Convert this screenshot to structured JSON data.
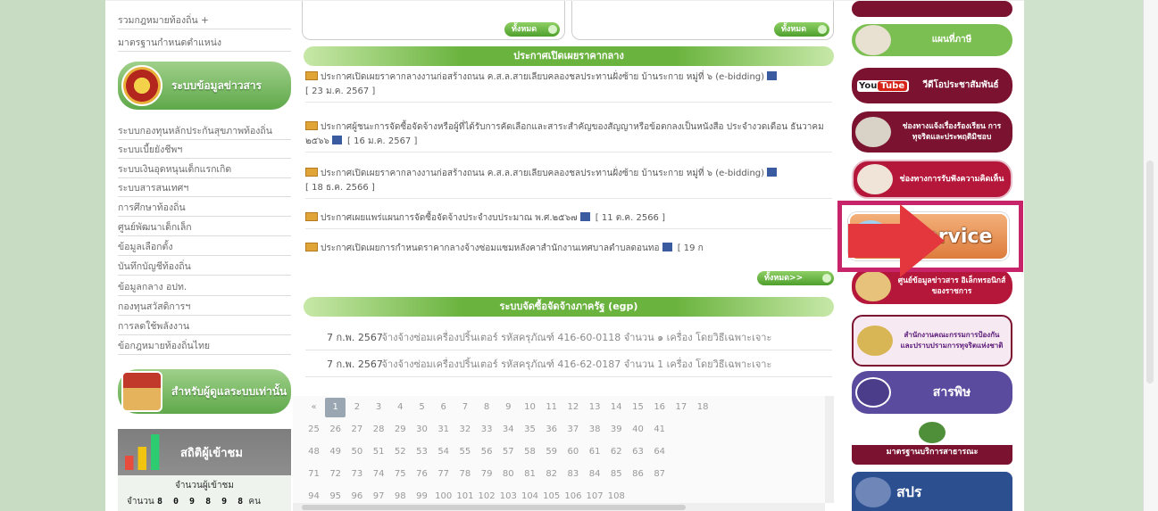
{
  "sidebar": {
    "top_links": [
      "รวมกฎหมายท้องถิ่น +",
      "มาตรฐานกำหนดตำแหน่ง"
    ],
    "banner_info": "ระบบข้อมูลข่าวสาร",
    "links": [
      "ระบบกองทุนหลักประกันสุขภาพท้องถิ่น",
      "ระบบเบี้ยยังชีพฯ",
      "ระบบเงินอุดหนุนเด็กแรกเกิด",
      "ระบบสารสนเทศฯ",
      "การศึกษาท้องถิ่น",
      "ศูนย์พัฒนาเด็กเล็ก",
      "ข้อมูลเลือกตั้ง",
      "บันทึกบัญชีท้องถิ่น",
      "ข้อมูลกลาง อปท.",
      "กองทุนสวัสดิการฯ",
      "การลดใช้พลังงาน",
      "ข้อกฎหมายท้องถิ่นไทย"
    ],
    "banner_admin": "สำหรับผู้ดูแลระบบเท่านั้น",
    "stats": {
      "title": "สถิติผู้เข้าชม",
      "label": "จำนวนผู้เข้าชม",
      "prefix": "จำนวน",
      "digits": "8 0 9 8 9 8",
      "suffix": "คน"
    }
  },
  "center": {
    "pill_all_1": "ทั้งหมด",
    "pill_all_2": "ทั้งหมด",
    "section_announce": "ประกาศเปิดเผยราคากลาง",
    "announcements": [
      {
        "text": "ประกาศเปิดเผยราคากลางงานก่อสร้างถนน ค.ส.ล.สายเลียบคลองชลประทานฝั่งซ้าย บ้านระกาย หมู่ที่ ๖ (e-bidding)",
        "date": "[ 23 ม.ค. 2567 ]"
      },
      {
        "text": "ประกาศผู้ชนะการจัดซื้อจัดจ้างหรือผู้ที่ได้รับการคัดเลือกและสาระสำคัญของสัญญาหรือข้อตกลงเป็นหนังสือ ประจำงวดเดือน ธันวาคม ๒๕๖๖",
        "date": "[ 16 ม.ค. 2567 ]"
      },
      {
        "text": "ประกาศเปิดเผยราคากลางงานก่อสร้างถนน ค.ส.ล.สายเลียบคลองชลประทานฝั่งซ้าย บ้านระกาย หมู่ที่ ๖ (e-bidding)",
        "date": "[ 18 ธ.ค. 2566 ]"
      },
      {
        "text": "ประกาศเผยแพร่แผนการจัดซื้อจัดจ้างประจำงบประมาณ พ.ศ.๒๕๖๗",
        "date": "[ 11 ต.ค. 2566 ]"
      },
      {
        "text": "ประกาศเปิดเผยการกำหนดราคากลางจ้างซ่อมแซมหลังคาสำนักงานเทศบาลตำบลดอนทอ",
        "date": "[ 19 ก"
      }
    ],
    "pill_all_more": "ทั้งหมด>>",
    "section_egp": "ระบบจัดซื้อจัดจ้างภาครัฐ (egp)",
    "egp_rows": [
      {
        "date": "7 ก.พ. 2567",
        "title": "จ้างจ้างซ่อมเครื่องปริ้นเตอร์ รหัสครุภัณฑ์ 416-60-0118 จำนวน ๑ เครื่อง โดยวิธีเฉพาะเจาะ"
      },
      {
        "date": "7 ก.พ. 2567",
        "title": "จ้างจ้างซ่อมเครื่องปริ้นเตอร์ รหัสครุภัณฑ์ 416-62-0187 จำนวน 1 เครื่อง โดยวิธีเฉพาะเจาะ"
      }
    ],
    "pager": {
      "rows": [
        [
          "«",
          "1",
          "2",
          "3",
          "4",
          "5",
          "6",
          "7",
          "8",
          "9",
          "10",
          "11",
          "12",
          "13",
          "14",
          "15",
          "16",
          "17",
          "18"
        ],
        [
          "25",
          "26",
          "27",
          "28",
          "29",
          "30",
          "31",
          "32",
          "33",
          "34",
          "35",
          "36",
          "37",
          "38",
          "39",
          "40",
          "41"
        ],
        [
          "48",
          "49",
          "50",
          "51",
          "52",
          "53",
          "54",
          "55",
          "56",
          "57",
          "58",
          "59",
          "60",
          "61",
          "62",
          "63",
          "64"
        ],
        [
          "71",
          "72",
          "73",
          "74",
          "75",
          "76",
          "77",
          "78",
          "79",
          "80",
          "81",
          "82",
          "83",
          "84",
          "85",
          "86",
          "87"
        ],
        [
          "94",
          "95",
          "96",
          "97",
          "98",
          "99",
          "100",
          "101",
          "102",
          "103",
          "104",
          "105",
          "106",
          "107",
          "108"
        ]
      ],
      "current": "1"
    }
  },
  "right": {
    "banners": [
      {
        "label": "แผนที่ภาษี",
        "color": "#7bbf52",
        "icon": "map-pin-icon"
      },
      {
        "label": "วีดีโอประชาสัมพันธ์",
        "color": "#7a1230",
        "icon": "video-camera-icon",
        "badge": "You",
        "badge2": "Tube"
      },
      {
        "label": "ช่องทางแจ้งเรื่องร้องเรียน การทุจริตและประพฤติมิชอบ",
        "color": "#7a1230",
        "icon": "person-icon"
      },
      {
        "label": "ช่องทางการรับฟังความคิดเห็น",
        "color": "#b5173a",
        "icon": "megaphone-icon"
      }
    ],
    "eservice": "E service",
    "lower_banners": [
      {
        "label": "ศูนย์ข้อมูลข่าวสาร อิเล็กทรอนิกส์ของราชการ",
        "color": "#b5173a",
        "icon": "emblem-icon"
      },
      {
        "label": "สำนักงานคณะกรรมการป้องกันและปราบปรามการทุจริตแห่งชาติ",
        "color": "#f7e9f1",
        "icon": "nacc-icon"
      },
      {
        "label": "สารพิษ",
        "color": "#5a4b9e",
        "icon": "scale-icon"
      },
      {
        "label": "มาตรฐานบริการสาธารณะ",
        "color": "#7a1230",
        "icon": "seal-icon"
      },
      {
        "label": "สปร",
        "color": "#2b4f8f",
        "icon": "globe-icon"
      }
    ]
  }
}
